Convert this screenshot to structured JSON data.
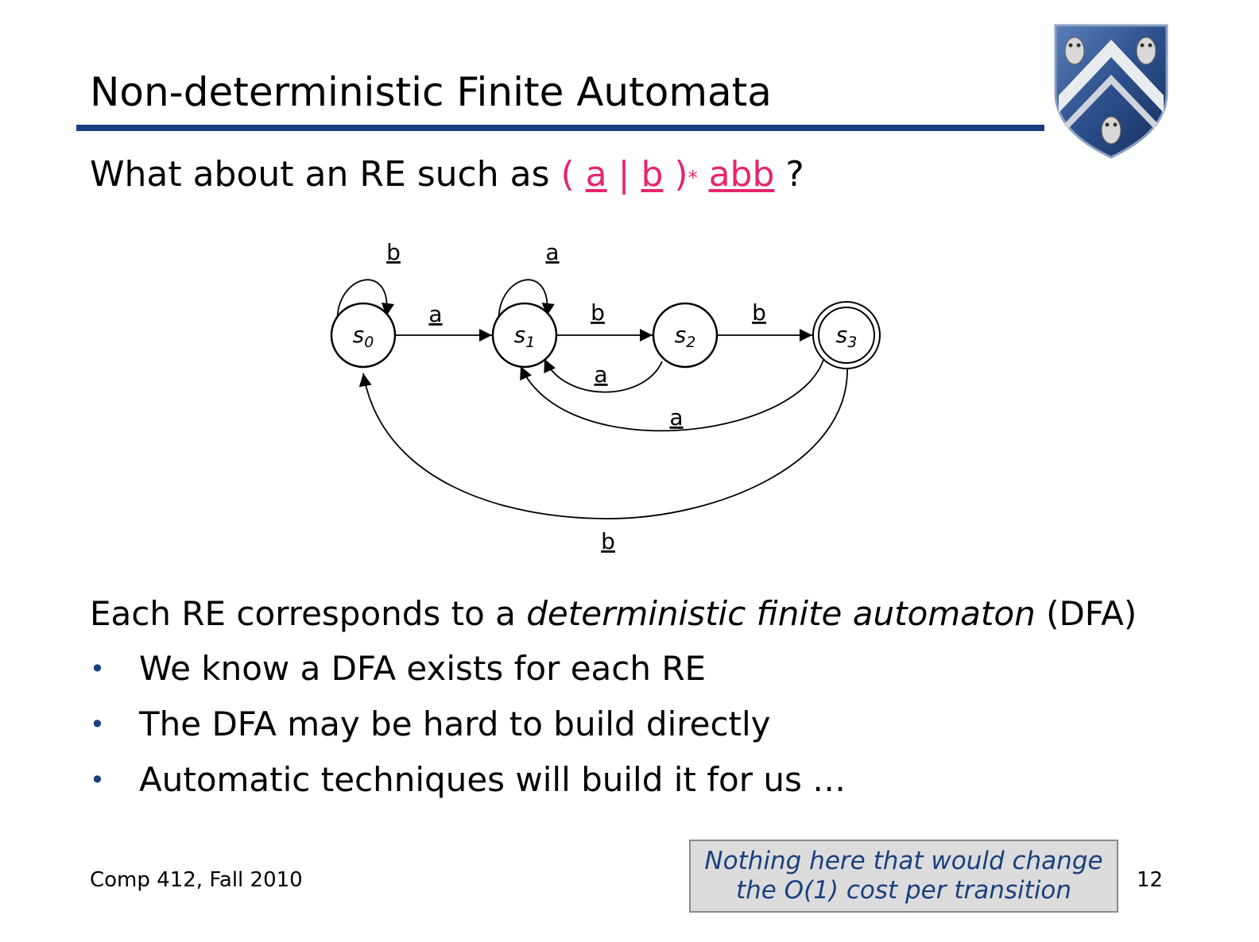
{
  "slide": {
    "title": "Non-deterministic Finite Automata",
    "question": {
      "prefix": "What about an RE such as",
      "open_paren": "(",
      "sym_a": "a",
      "bar": "|",
      "sym_b": "b",
      "close_paren": ")",
      "star": "*",
      "suffix": "abb",
      "question_mark": "?"
    },
    "statement": {
      "prefix": "Each RE corresponds to a ",
      "emphasis": "deterministic finite automaton",
      "suffix": " (DFA)"
    },
    "bullets": [
      "We know a DFA exists for each RE",
      "The DFA may be hard to build directly",
      "Automatic techniques will build it for us …"
    ],
    "footer_left": "Comp 412, Fall 2010",
    "note": {
      "line1": "Nothing here that would change",
      "line2": "the O(1) cost per transition"
    },
    "page_number": "12"
  },
  "diagram": {
    "states": [
      {
        "id": "s0",
        "letter": "s",
        "sub": "0",
        "accepting": false
      },
      {
        "id": "s1",
        "letter": "s",
        "sub": "1",
        "accepting": false
      },
      {
        "id": "s2",
        "letter": "s",
        "sub": "2",
        "accepting": false
      },
      {
        "id": "s3",
        "letter": "s",
        "sub": "3",
        "accepting": true
      }
    ],
    "transitions": [
      {
        "from": "s0",
        "to": "s0",
        "label": "b"
      },
      {
        "from": "s1",
        "to": "s1",
        "label": "a"
      },
      {
        "from": "s0",
        "to": "s1",
        "label": "a"
      },
      {
        "from": "s1",
        "to": "s2",
        "label": "b"
      },
      {
        "from": "s2",
        "to": "s3",
        "label": "b"
      },
      {
        "from": "s2",
        "to": "s1",
        "label": "a"
      },
      {
        "from": "s3",
        "to": "s1",
        "label": "a"
      },
      {
        "from": "s3",
        "to": "s0",
        "label": "b"
      }
    ]
  },
  "colors": {
    "accent_blue": "#1a3f7e",
    "highlight_pink": "#e8246f",
    "note_background": "#dcdcdc"
  },
  "logo": {
    "name": "shield-crest-icon",
    "lettering": ""
  }
}
